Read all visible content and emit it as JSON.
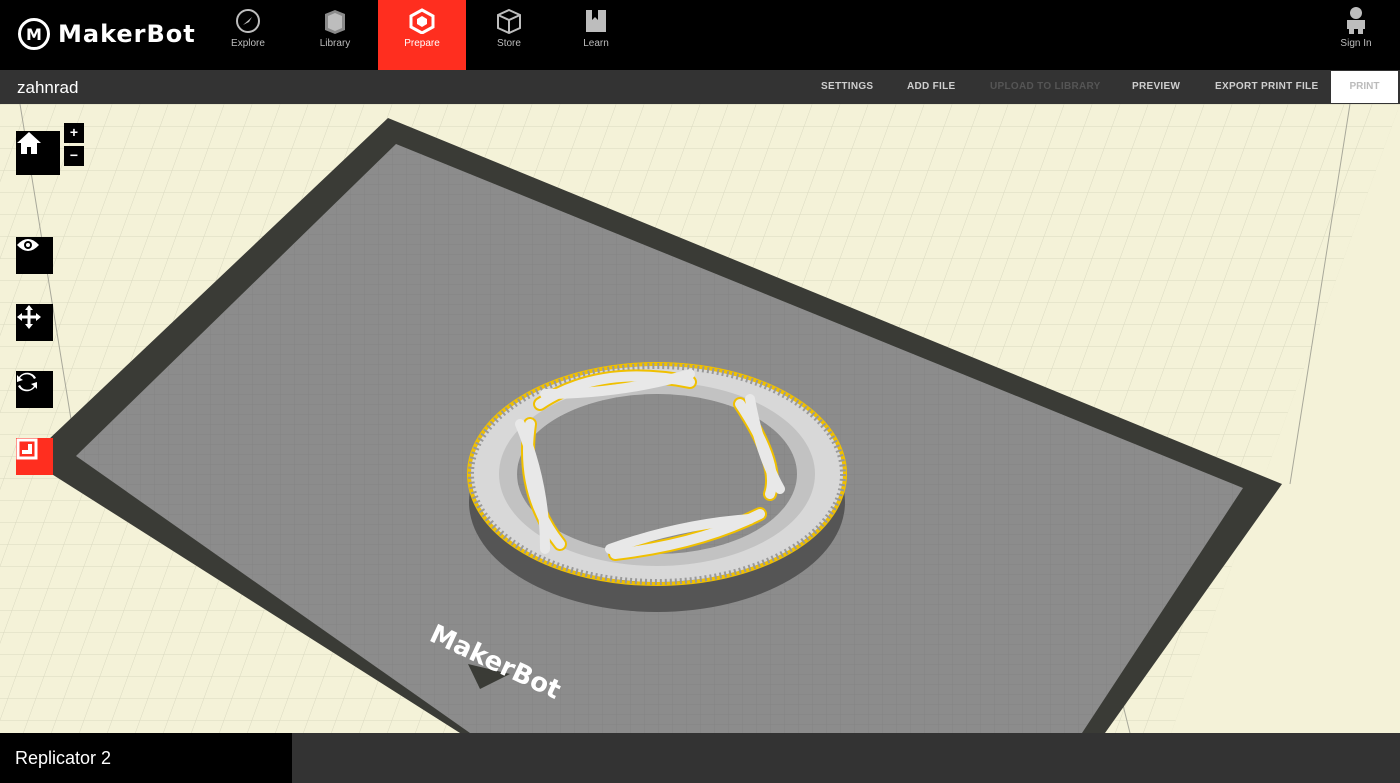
{
  "app": {
    "brand": "MakerBot",
    "logo_letter": "M"
  },
  "nav": {
    "tabs": [
      {
        "label": "Explore",
        "icon": "compass-icon"
      },
      {
        "label": "Library",
        "icon": "library-icon"
      },
      {
        "label": "Prepare",
        "icon": "prepare-cube-icon",
        "active": true
      },
      {
        "label": "Store",
        "icon": "store-box-icon"
      },
      {
        "label": "Learn",
        "icon": "learn-book-icon"
      }
    ],
    "sign_in": "Sign In"
  },
  "file": {
    "name": "zahnrad",
    "actions": {
      "settings": "SETTINGS",
      "add_file": "ADD FILE",
      "upload": "UPLOAD TO LIBRARY",
      "preview": "PREVIEW",
      "export": "EXPORT PRINT FILE",
      "print": "PRINT"
    }
  },
  "viewport": {
    "plate_brand": "MakerBot",
    "tools": [
      "home-icon",
      "zoom-in",
      "zoom-out",
      "view-eye-icon",
      "move-arrows-icon",
      "rotate-icon",
      "scale-icon"
    ],
    "zoom_in": "+",
    "zoom_out": "−"
  },
  "status": {
    "printer": "Replicator 2"
  },
  "colors": {
    "accent": "#ff2e1f",
    "bg": "#f4f2d8",
    "plate": "#8c8c8c",
    "frame": "#3a3b36",
    "selection": "#f0c000"
  }
}
